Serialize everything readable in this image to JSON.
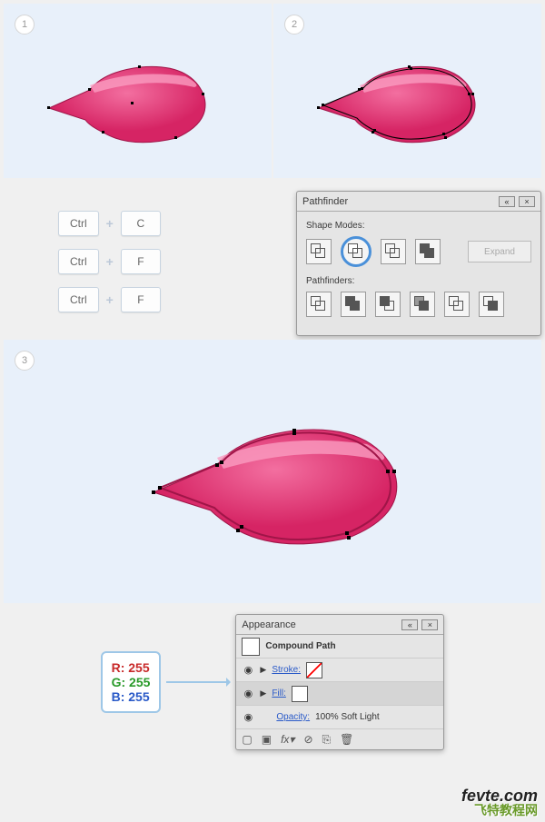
{
  "steps": {
    "s1": "1",
    "s2": "2",
    "s3": "3"
  },
  "keys": {
    "rows": [
      {
        "mod": "Ctrl",
        "key": "C"
      },
      {
        "mod": "Ctrl",
        "key": "F"
      },
      {
        "mod": "Ctrl",
        "key": "F"
      }
    ],
    "plus": "+"
  },
  "pathfinder": {
    "title": "Pathfinder",
    "shape_modes_label": "Shape Modes:",
    "pathfinders_label": "Pathfinders:",
    "expand": "Expand",
    "shape_modes": [
      "unite",
      "minus-front",
      "intersect",
      "exclude"
    ],
    "pathfinders": [
      "divide",
      "trim",
      "merge",
      "crop",
      "outline",
      "minus-back"
    ]
  },
  "appearance": {
    "title": "Appearance",
    "object_type": "Compound Path",
    "stroke_label": "Stroke:",
    "fill_label": "Fill:",
    "opacity_label": "Opacity:",
    "opacity_value": "100% Soft Light"
  },
  "rgb": {
    "r": "R: 255",
    "g": "G: 255",
    "b": "B: 255"
  },
  "watermark": {
    "line1": "fevte.com",
    "line2": "飞特教程网"
  }
}
